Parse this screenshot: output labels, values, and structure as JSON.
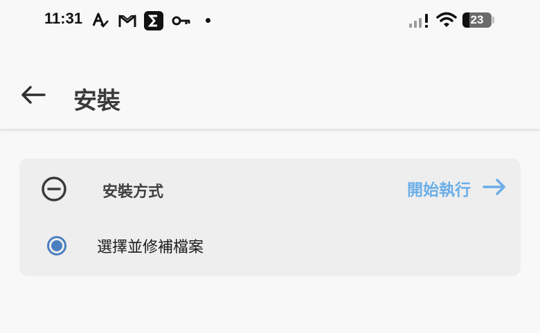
{
  "status_bar": {
    "time": "11:31",
    "battery_percent": "23",
    "battery_level": 0.23,
    "icons": [
      "spellcheck-icon",
      "gmail-icon",
      "sigma-app-icon",
      "key-icon",
      "notification-dot-icon",
      "signal-icon",
      "wifi-icon",
      "battery-icon"
    ]
  },
  "app_bar": {
    "title": "安裝",
    "back_icon": "arrow-left-icon"
  },
  "install_card": {
    "section_label": "安裝方式",
    "collapse_icon": "minus-circle-icon",
    "run_label": "開始執行",
    "run_icon": "arrow-right-icon",
    "option": {
      "label": "選擇並修補檔案",
      "selected": true
    }
  },
  "colors": {
    "accent": "#6aaee8",
    "radio": "#4a7fc0",
    "card_bg": "#eeeeee",
    "page_bg": "#f8f8f8"
  }
}
